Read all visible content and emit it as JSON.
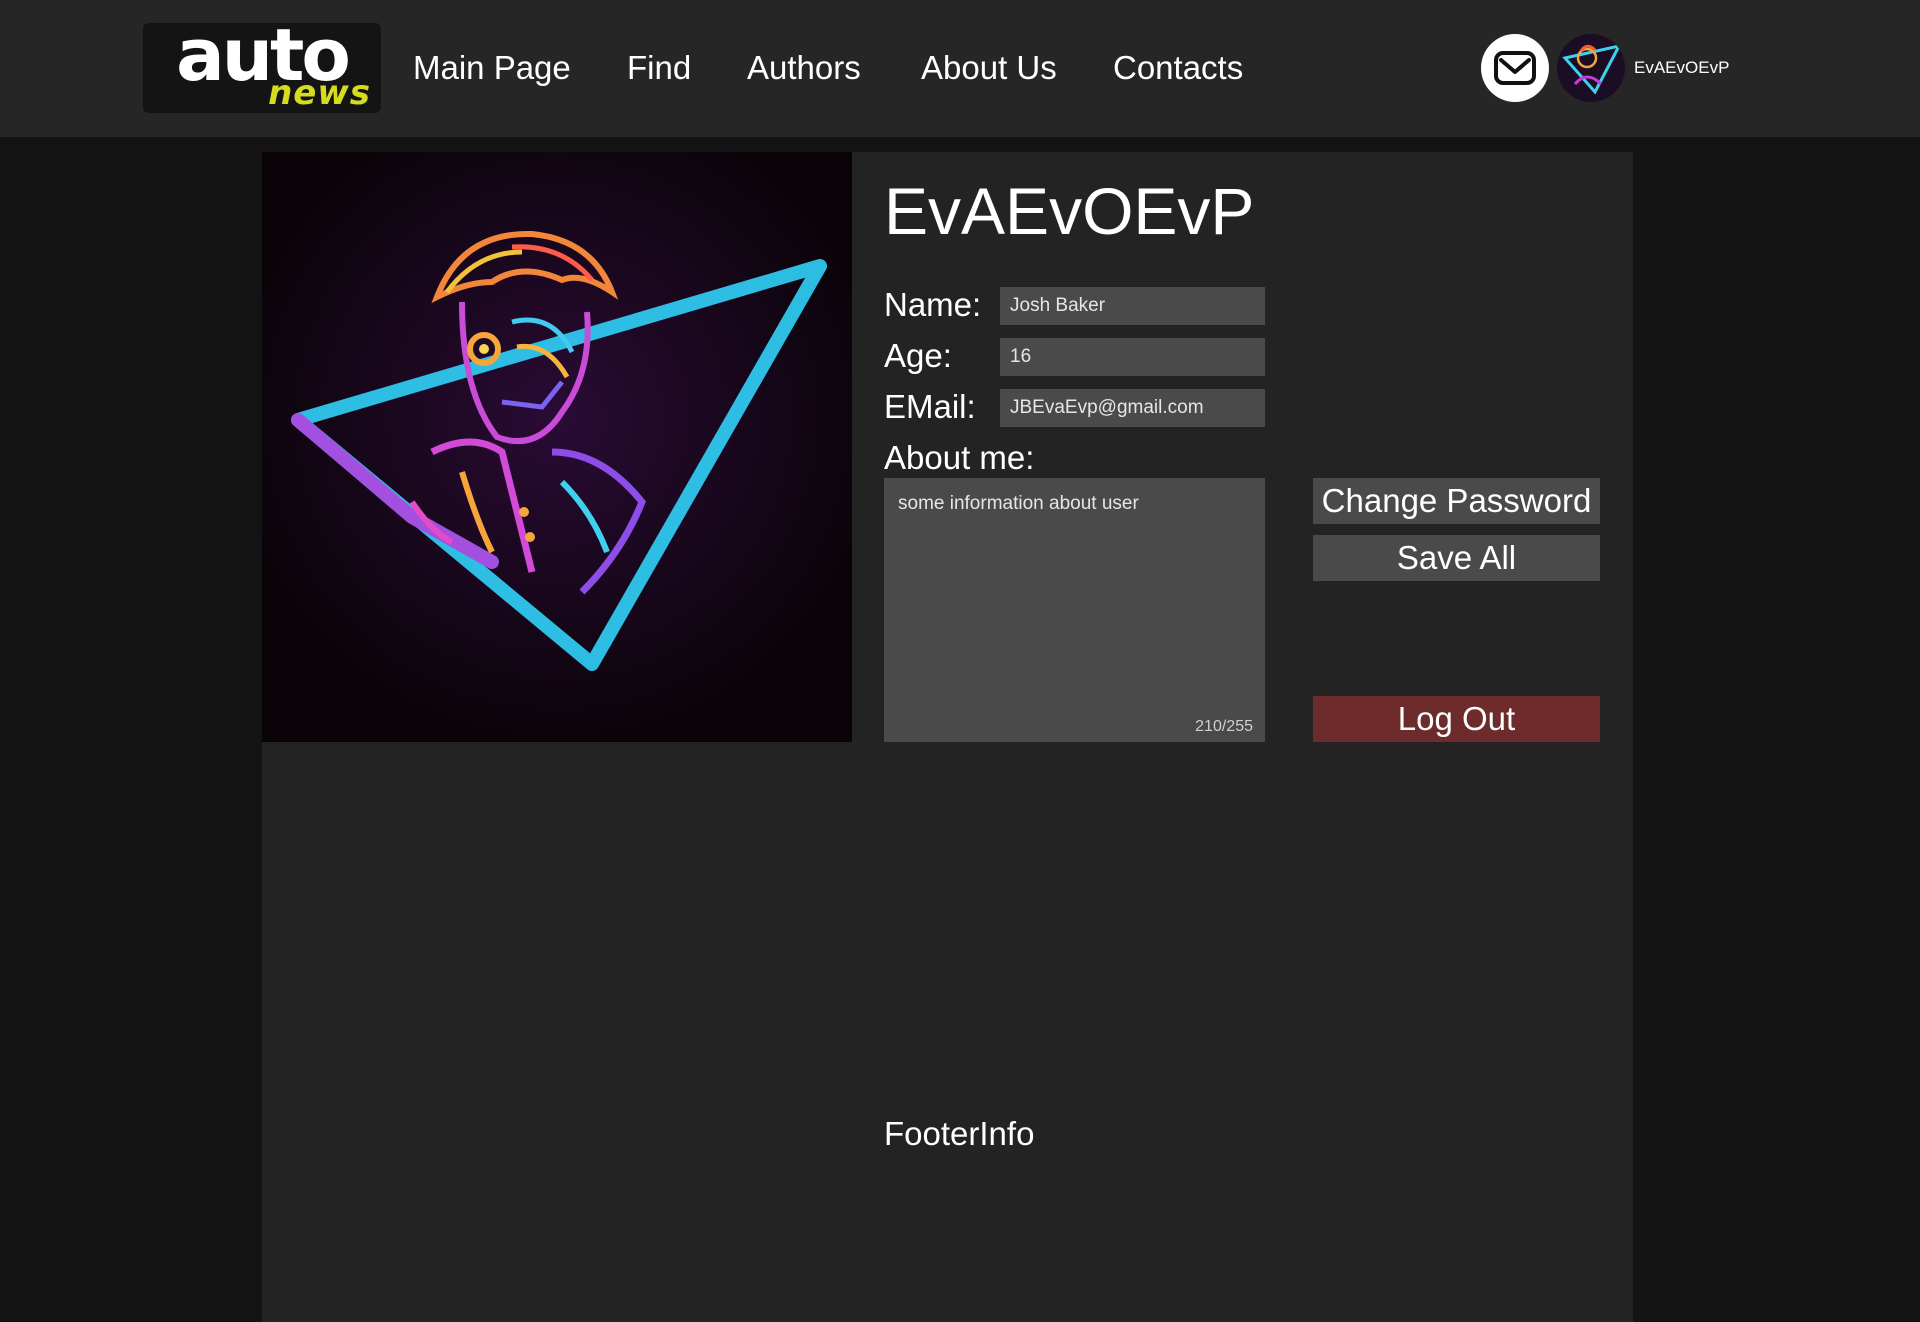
{
  "header": {
    "logo": {
      "top": "auto",
      "bottom": "news"
    },
    "nav": [
      {
        "label": "Main Page"
      },
      {
        "label": "Find"
      },
      {
        "label": "Authors"
      },
      {
        "label": "About Us"
      },
      {
        "label": "Contacts"
      }
    ],
    "mail_icon": "envelope-icon",
    "user": {
      "name": "EvAEvOEvP",
      "avatar_icon": "neon-avatar"
    }
  },
  "profile": {
    "title": "EvAEvOEvP",
    "fields": {
      "name": {
        "label": "Name:",
        "value": "Josh Baker"
      },
      "age": {
        "label": "Age:",
        "value": "16"
      },
      "email": {
        "label": "EMail:",
        "value": "JBEvaEvp@gmail.com"
      }
    },
    "about": {
      "label": "About me:",
      "value": "some information about user",
      "counter": "210/255"
    },
    "buttons": {
      "change_password": "Change Password",
      "save_all": "Save All",
      "log_out": "Log Out"
    }
  },
  "footer": {
    "info": "FooterInfo"
  },
  "colors": {
    "header_bg": "#262627",
    "page_bg": "#131314",
    "panel_bg": "#232324",
    "input_bg": "#4a4a4b",
    "logout_bg": "#6e2b2c",
    "logo_accent": "#d4dc1d"
  }
}
